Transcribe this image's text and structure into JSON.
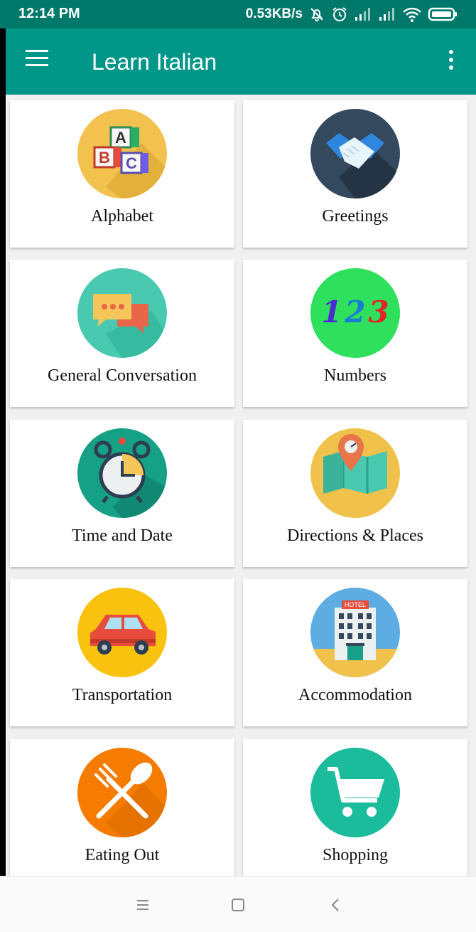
{
  "status_bar": {
    "time": "12:14 PM",
    "network_speed": "0.53KB/s",
    "icons": [
      "alarm-off-icon",
      "alarm-clock-icon",
      "signal-icon",
      "signal-icon",
      "wifi-icon",
      "battery-icon"
    ]
  },
  "app_bar": {
    "title": "Learn Italian",
    "menu_icon": "hamburger-menu-icon",
    "overflow_icon": "more-vert-icon",
    "color": "#009688"
  },
  "categories": [
    {
      "label": "Alphabet",
      "icon": "abc-blocks-icon",
      "color": "#f2c14e"
    },
    {
      "label": "Greetings",
      "icon": "handshake-icon",
      "color": "#34495e"
    },
    {
      "label": "General Conversation",
      "icon": "chat-bubbles-icon",
      "color": "#48c9b0"
    },
    {
      "label": "Numbers",
      "icon": "numbers-123-icon",
      "color": "#2ee05b"
    },
    {
      "label": "Time and Date",
      "icon": "alarm-clock-icon",
      "color": "#16a085"
    },
    {
      "label": "Directions & Places",
      "icon": "map-pin-icon",
      "color": "#f0c24b"
    },
    {
      "label": "Transportation",
      "icon": "car-icon",
      "color": "#f9c20e"
    },
    {
      "label": "Accommodation",
      "icon": "hotel-icon",
      "color": "#5dade2"
    },
    {
      "label": "Eating Out",
      "icon": "fork-spoon-icon",
      "color": "#f57c00"
    },
    {
      "label": "Shopping",
      "icon": "shopping-cart-icon",
      "color": "#1abc9c"
    }
  ],
  "nav_bar": {
    "icons": [
      "recents-icon",
      "home-icon",
      "back-icon"
    ]
  }
}
